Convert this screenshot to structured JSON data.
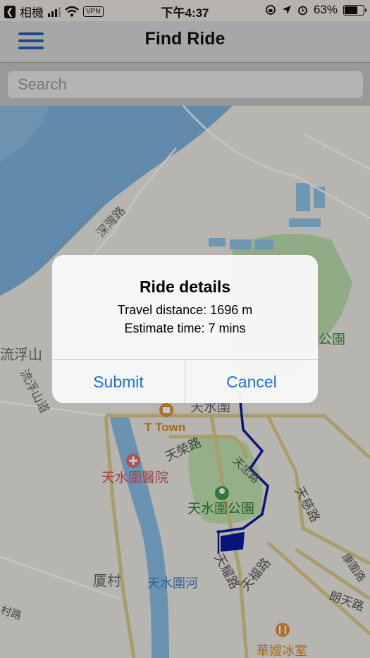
{
  "status_bar": {
    "back_app": "相機",
    "vpn": "VPN",
    "time": "下午4:37",
    "battery": "63%"
  },
  "nav": {
    "title": "Find Ride"
  },
  "search": {
    "placeholder": "Search"
  },
  "map": {
    "labels": {
      "road_sham_wan": "深灣路",
      "hill_lau_fau": "流浮山",
      "road_lau_fau": "流浮山道",
      "park_partial": "公園",
      "tin_shui_wai_partial": "天水圍",
      "t_town": "T Town",
      "road_tin_wing": "天榮路",
      "road_tin_chung": "天忠路",
      "hospital": "天水圍醫院",
      "park": "天水圍公園",
      "road_tin_tsz": "天慈路",
      "road_tin_yiu": "天耀路",
      "road_tin_fuk": "天福路",
      "road_kong_pui": "康圍路",
      "ha_tsuen": "厦村",
      "river": "天水圍河",
      "road_long_tin": "朗天路",
      "road_tsuen": "村路",
      "cafe": "華嫂冰室"
    }
  },
  "dialog": {
    "title": "Ride details",
    "distance": "Travel distance: 1696 m",
    "time": "Estimate time: 7 mins",
    "submit": "Submit",
    "cancel": "Cancel"
  }
}
